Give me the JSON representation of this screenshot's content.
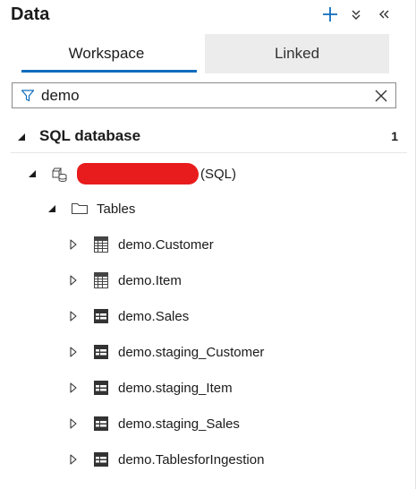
{
  "panel": {
    "title": "Data"
  },
  "tabs": [
    {
      "label": "Workspace",
      "active": true
    },
    {
      "label": "Linked",
      "active": false
    }
  ],
  "search": {
    "value": "demo",
    "placeholder": ""
  },
  "section": {
    "label": "SQL database",
    "count": "1"
  },
  "database": {
    "suffix": "(SQL)"
  },
  "folder": {
    "label": "Tables"
  },
  "tables": [
    {
      "name": "demo.Customer",
      "icon": "table-icon"
    },
    {
      "name": "demo.Item",
      "icon": "table-icon"
    },
    {
      "name": "demo.Sales",
      "icon": "external-table-icon"
    },
    {
      "name": "demo.staging_Customer",
      "icon": "external-table-icon"
    },
    {
      "name": "demo.staging_Item",
      "icon": "external-table-icon"
    },
    {
      "name": "demo.staging_Sales",
      "icon": "external-table-icon"
    },
    {
      "name": "demo.TablesforIngestion",
      "icon": "external-table-icon"
    }
  ],
  "colors": {
    "accent": "#0f6cbd",
    "redaction": "#e81c1c",
    "tab_inactive_bg": "#ececec"
  }
}
